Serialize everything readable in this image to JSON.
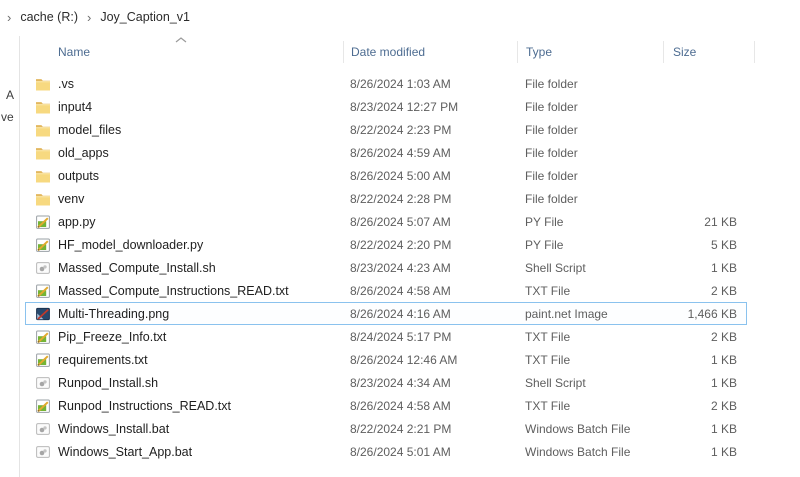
{
  "breadcrumb": {
    "items": [
      {
        "label": "cache (R:)"
      },
      {
        "label": "Joy_Caption_v1"
      }
    ],
    "separator": "›"
  },
  "nav_pane_fragments": {
    "fragment1": "A",
    "fragment2": "ve"
  },
  "columns": {
    "name": "Name",
    "date": "Date modified",
    "type": "Type",
    "size": "Size"
  },
  "sort": {
    "column": "Name",
    "direction": "ascending"
  },
  "rows": [
    {
      "name": ".vs",
      "date": "8/26/2024 1:03 AM",
      "type": "File folder",
      "size": "",
      "icon": "folder",
      "selected": false
    },
    {
      "name": "input4",
      "date": "8/23/2024 12:27 PM",
      "type": "File folder",
      "size": "",
      "icon": "folder",
      "selected": false
    },
    {
      "name": "model_files",
      "date": "8/22/2024 2:23 PM",
      "type": "File folder",
      "size": "",
      "icon": "folder",
      "selected": false
    },
    {
      "name": "old_apps",
      "date": "8/26/2024 4:59 AM",
      "type": "File folder",
      "size": "",
      "icon": "folder",
      "selected": false
    },
    {
      "name": "outputs",
      "date": "8/26/2024 5:00 AM",
      "type": "File folder",
      "size": "",
      "icon": "folder",
      "selected": false
    },
    {
      "name": "venv",
      "date": "8/22/2024 2:28 PM",
      "type": "File folder",
      "size": "",
      "icon": "folder",
      "selected": false
    },
    {
      "name": "app.py",
      "date": "8/26/2024 5:07 AM",
      "type": "PY File",
      "size": "21 KB",
      "icon": "editor",
      "selected": false
    },
    {
      "name": "HF_model_downloader.py",
      "date": "8/22/2024 2:20 PM",
      "type": "PY File",
      "size": "5 KB",
      "icon": "editor",
      "selected": false
    },
    {
      "name": "Massed_Compute_Install.sh",
      "date": "8/23/2024 4:23 AM",
      "type": "Shell Script",
      "size": "1 KB",
      "icon": "script",
      "selected": false
    },
    {
      "name": "Massed_Compute_Instructions_READ.txt",
      "date": "8/26/2024 4:58 AM",
      "type": "TXT File",
      "size": "2 KB",
      "icon": "editor",
      "selected": false
    },
    {
      "name": "Multi-Threading.png",
      "date": "8/26/2024 4:16 AM",
      "type": "paint.net Image",
      "size": "1,466 KB",
      "icon": "paintnet",
      "selected": true
    },
    {
      "name": "Pip_Freeze_Info.txt",
      "date": "8/24/2024 5:17 PM",
      "type": "TXT File",
      "size": "2 KB",
      "icon": "editor",
      "selected": false
    },
    {
      "name": "requirements.txt",
      "date": "8/26/2024 12:46 AM",
      "type": "TXT File",
      "size": "1 KB",
      "icon": "editor",
      "selected": false
    },
    {
      "name": "Runpod_Install.sh",
      "date": "8/23/2024 4:34 AM",
      "type": "Shell Script",
      "size": "1 KB",
      "icon": "script",
      "selected": false
    },
    {
      "name": "Runpod_Instructions_READ.txt",
      "date": "8/26/2024 4:58 AM",
      "type": "TXT File",
      "size": "2 KB",
      "icon": "editor",
      "selected": false
    },
    {
      "name": "Windows_Install.bat",
      "date": "8/22/2024 2:21 PM",
      "type": "Windows Batch File",
      "size": "1 KB",
      "icon": "script",
      "selected": false
    },
    {
      "name": "Windows_Start_App.bat",
      "date": "8/26/2024 5:01 AM",
      "type": "Windows Batch File",
      "size": "1 KB",
      "icon": "script",
      "selected": false
    }
  ],
  "colors": {
    "header_text": "#4d6c91",
    "secondary_text": "#5e5e5e",
    "selection_border": "#8ac2ee",
    "folder_yellow": "#f7d980"
  }
}
